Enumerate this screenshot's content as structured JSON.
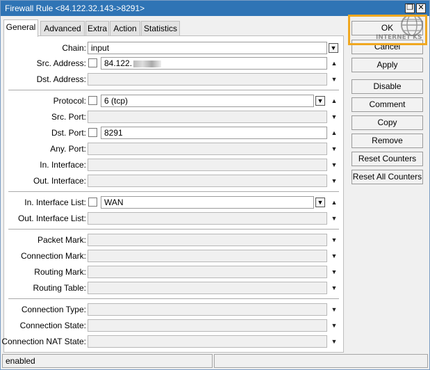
{
  "window": {
    "title": "Firewall Rule <84.122.32.143->8291>",
    "restore_glyph": "❐",
    "close_glyph": "✕"
  },
  "tabs": [
    {
      "label": "General"
    },
    {
      "label": "Advanced"
    },
    {
      "label": "Extra"
    },
    {
      "label": "Action"
    },
    {
      "label": "Statistics"
    }
  ],
  "fields": {
    "chain": {
      "label": "Chain:",
      "value": "input"
    },
    "src_address": {
      "label": "Src. Address:",
      "value": "84.122."
    },
    "dst_address": {
      "label": "Dst. Address:",
      "value": ""
    },
    "protocol": {
      "label": "Protocol:",
      "value": "6 (tcp)"
    },
    "src_port": {
      "label": "Src. Port:",
      "value": ""
    },
    "dst_port": {
      "label": "Dst. Port:",
      "value": "8291"
    },
    "any_port": {
      "label": "Any. Port:",
      "value": ""
    },
    "in_interface": {
      "label": "In. Interface:",
      "value": ""
    },
    "out_interface": {
      "label": "Out. Interface:",
      "value": ""
    },
    "in_interface_list": {
      "label": "In. Interface List:",
      "value": "WAN"
    },
    "out_interface_list": {
      "label": "Out. Interface List:",
      "value": ""
    },
    "packet_mark": {
      "label": "Packet Mark:",
      "value": ""
    },
    "connection_mark": {
      "label": "Connection Mark:",
      "value": ""
    },
    "routing_mark": {
      "label": "Routing Mark:",
      "value": ""
    },
    "routing_table": {
      "label": "Routing Table:",
      "value": ""
    },
    "connection_type": {
      "label": "Connection Type:",
      "value": ""
    },
    "connection_state": {
      "label": "Connection State:",
      "value": ""
    },
    "connection_nat_state": {
      "label": "Connection NAT State:",
      "value": ""
    }
  },
  "buttons": {
    "ok": "OK",
    "cancel": "Cancel",
    "apply": "Apply",
    "disable": "Disable",
    "comment": "Comment",
    "copy": "Copy",
    "remove": "Remove",
    "reset_counters": "Reset Counters",
    "reset_all_counters": "Reset All Counters"
  },
  "watermark": "INTERNET KS",
  "status": {
    "state": "enabled"
  },
  "colors": {
    "titlebar": "#2f74b5",
    "highlight": "#f0a820"
  }
}
